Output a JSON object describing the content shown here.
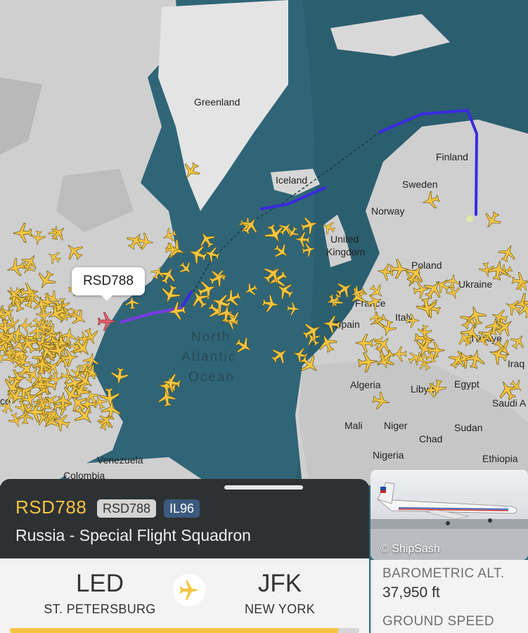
{
  "map": {
    "country_labels": [
      "Greenland",
      "Iceland",
      "Finland",
      "Sweden",
      "Norway",
      "United",
      "Kingdom",
      "Poland",
      "Ukraine",
      "Spain",
      "France",
      "Italy",
      "Türkiye",
      "Iraq",
      "Algeria",
      "Libya",
      "Egypt",
      "Saudi A",
      "Mali",
      "Niger",
      "Chad",
      "Sudan",
      "Nigeria",
      "Ethiopia",
      "Venezuela",
      "Colombia",
      "co"
    ],
    "ocean_label": [
      "North",
      "Atlantic",
      "Ocean"
    ],
    "selected_callout": "RSD788",
    "colors": {
      "land": "#cfcfcf",
      "ocean": "#2f6577",
      "aircraft": "#f5c542",
      "selected_aircraft": "#e35d6a",
      "track": "#3a2be0"
    }
  },
  "flight": {
    "callsign": "RSD788",
    "callsign_badge": "RSD788",
    "aircraft_badge": "IL96",
    "airline": "Russia - Special Flight Squadron",
    "origin_code": "LED",
    "origin_city": "ST. PETERSBURG",
    "destination_code": "JFK",
    "destination_city": "NEW YORK",
    "route_icon": "airplane-icon",
    "progress_fraction": 0.94
  },
  "photo": {
    "credit": "© ShipSash"
  },
  "stats": {
    "baro_alt_label": "BAROMETRIC ALT.",
    "baro_alt_value": "37,950 ft",
    "ground_speed_label": "GROUND SPEED"
  }
}
